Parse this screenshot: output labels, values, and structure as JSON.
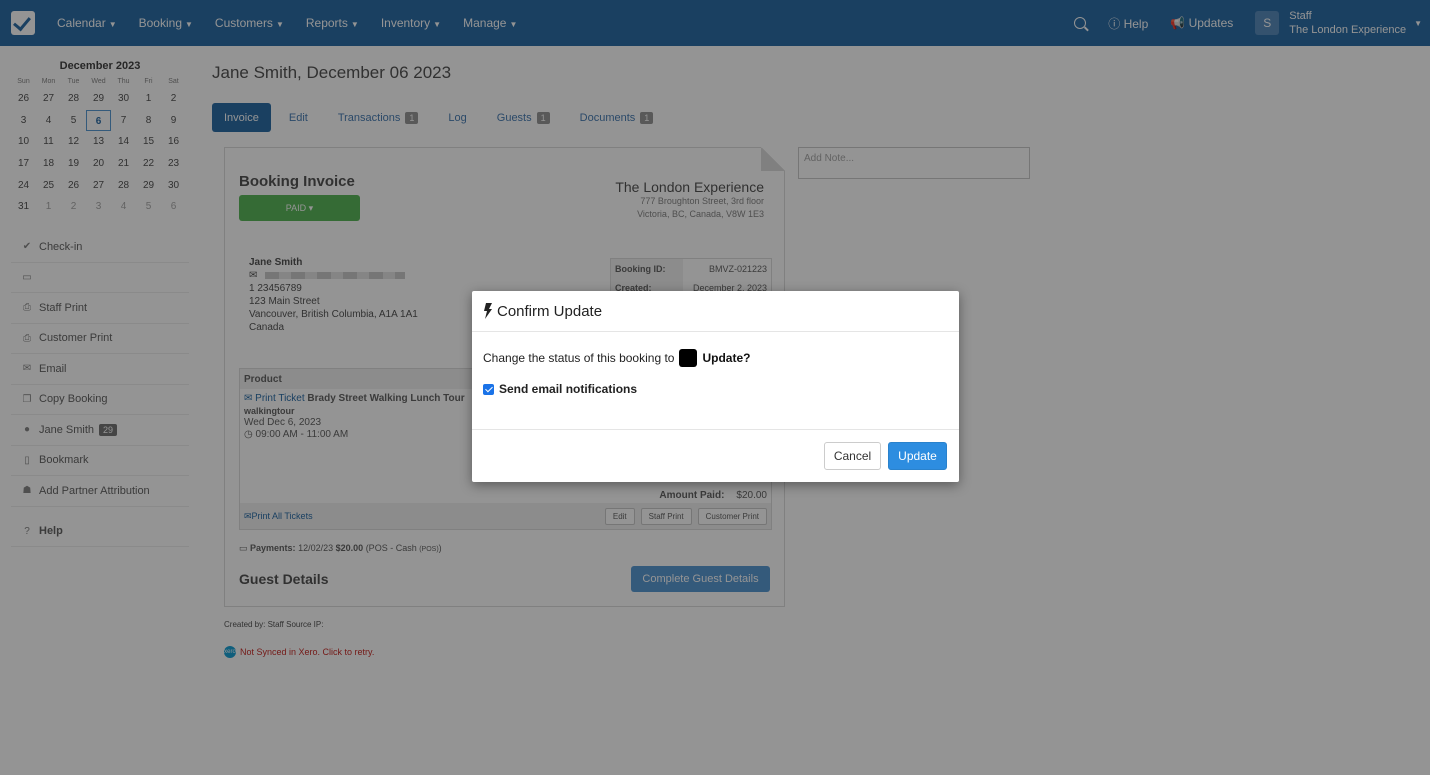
{
  "nav": {
    "items": [
      "Calendar",
      "Booking",
      "Customers",
      "Reports",
      "Inventory",
      "Manage"
    ],
    "help": "Help",
    "updates": "Updates",
    "avatar_letter": "S",
    "user_role": "Staff",
    "user_company": "The London Experience"
  },
  "calendar": {
    "title": "December 2023",
    "dow": [
      "Sun",
      "Mon",
      "Tue",
      "Wed",
      "Thu",
      "Fri",
      "Sat"
    ],
    "weeks": [
      [
        "26",
        "27",
        "28",
        "29",
        "30",
        "1",
        "2"
      ],
      [
        "3",
        "4",
        "5",
        "6",
        "7",
        "8",
        "9"
      ],
      [
        "10",
        "11",
        "12",
        "13",
        "14",
        "15",
        "16"
      ],
      [
        "17",
        "18",
        "19",
        "20",
        "21",
        "22",
        "23"
      ],
      [
        "24",
        "25",
        "26",
        "27",
        "28",
        "29",
        "30"
      ],
      [
        "31",
        "1",
        "2",
        "3",
        "4",
        "5",
        "6"
      ]
    ],
    "today": "6"
  },
  "sidebar": {
    "checkin": "Check-in",
    "staff_print": "Staff Print",
    "customer_print": "Customer Print",
    "email": "Email",
    "copy_booking": "Copy Booking",
    "customer": "Jane Smith",
    "customer_badge": "29",
    "bookmark": "Bookmark",
    "partner": "Add Partner Attribution",
    "help": "Help"
  },
  "page": {
    "title": "Jane Smith, December 06 2023",
    "tabs": [
      {
        "label": "Invoice",
        "badge": ""
      },
      {
        "label": "Edit",
        "badge": ""
      },
      {
        "label": "Transactions",
        "badge": "1"
      },
      {
        "label": "Log",
        "badge": ""
      },
      {
        "label": "Guests",
        "badge": "1"
      },
      {
        "label": "Documents",
        "badge": "1"
      }
    ],
    "note_placeholder": "Add Note..."
  },
  "invoice": {
    "title": "Booking Invoice",
    "paid_label": "PAID",
    "company_name": "The London Experience",
    "company_addr1": "777 Broughton Street, 3rd floor",
    "company_addr2": "Victoria, BC, Canada, V8W 1E3",
    "customer_name": "Jane Smith",
    "phone": "1 23456789",
    "addr1": "123 Main Street",
    "addr2": "Vancouver, British Columbia, A1A 1A1",
    "addr3": "Canada",
    "booking_id_label": "Booking ID:",
    "booking_id": "BMVZ-021223",
    "created_label": "Created:",
    "created": "December 2, 2023",
    "product_header": "Product",
    "print_ticket": "Print Ticket",
    "product_name": "Brady Street Walking Lunch Tour",
    "product_code": "walkingtour",
    "product_date": "Wed Dec 6, 2023",
    "product_time": "09:00 AM - 11:00 AM",
    "amount_paid_label": "Amount Paid:",
    "amount_paid": "$20.00",
    "print_all": "Print All Tickets",
    "foot_edit": "Edit",
    "foot_staff_print": "Staff Print",
    "foot_customer_print": "Customer Print",
    "payments_label": "Payments:",
    "payments_date": "12/02/23",
    "payments_amount": "$20.00",
    "payments_method": "(POS - Cash",
    "payments_tag": "(POS)",
    "payments_close": ")",
    "guest_title": "Guest Details",
    "guest_btn": "Complete Guest Details"
  },
  "footer": {
    "created_by": "Created by: Staff Source IP:",
    "xero_icon": "xero",
    "xero": "Not Synced in Xero. Click to retry."
  },
  "modal": {
    "title": "Confirm Update",
    "message": "Change the status of this booking to",
    "status_suffix": "Update?",
    "notify_label": "Send email notifications",
    "notify_checked": true,
    "cancel_label": "Cancel",
    "update_label": "Update",
    "primary_color": "#2d8de0"
  }
}
